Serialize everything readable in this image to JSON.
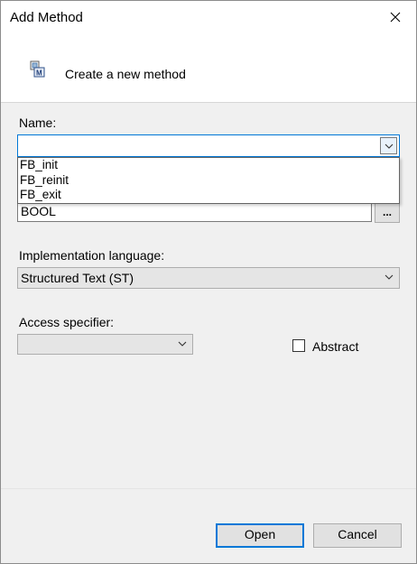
{
  "window": {
    "title": "Add Method"
  },
  "header": {
    "icon": "method-icon",
    "text": "Create a new method"
  },
  "name_field": {
    "label": "Name:",
    "value": "",
    "options": [
      "FB_init",
      "FB_reinit",
      "FB_exit"
    ]
  },
  "return_type": {
    "value": "BOOL",
    "browse_label": "..."
  },
  "implementation_language": {
    "label": "Implementation language:",
    "value": "Structured Text (ST)"
  },
  "access_specifier": {
    "label": "Access specifier:",
    "value": ""
  },
  "abstract": {
    "label": "Abstract",
    "checked": false
  },
  "buttons": {
    "open": "Open",
    "cancel": "Cancel"
  },
  "colors": {
    "accent": "#0078d7",
    "dialog_bg": "#f0f0f0",
    "header_bg": "#ffffff"
  }
}
